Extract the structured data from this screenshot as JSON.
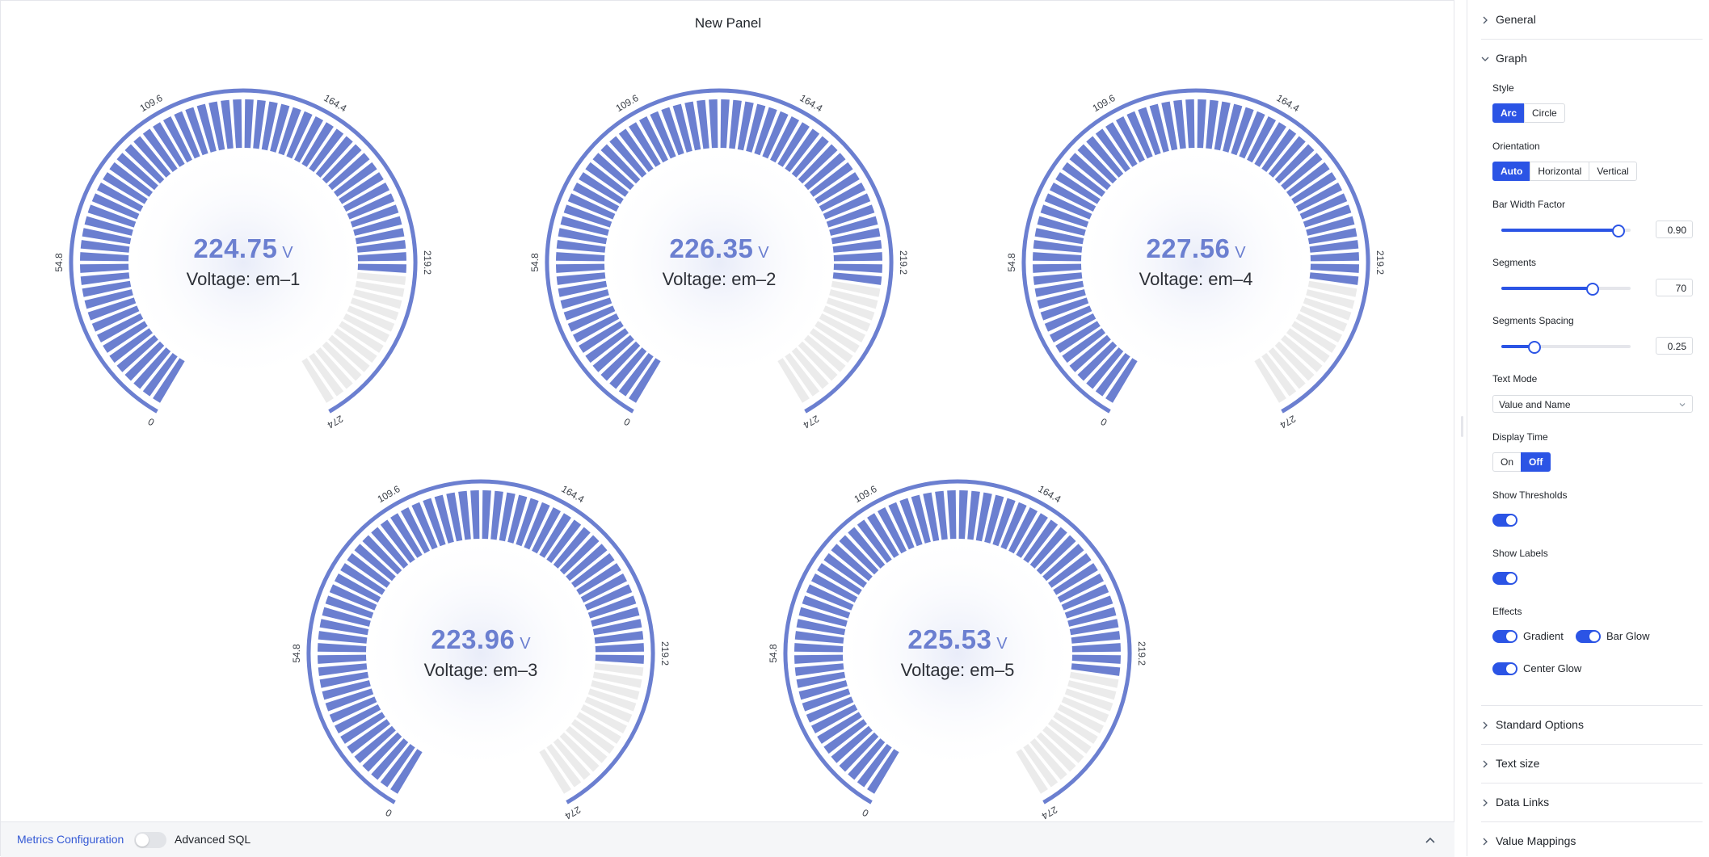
{
  "panel": {
    "title": "New Panel"
  },
  "gauges": [
    {
      "value": "224.75",
      "unit": "V",
      "name": "Voltage: em–1",
      "numeric_value": 224.75
    },
    {
      "value": "226.35",
      "unit": "V",
      "name": "Voltage: em–2",
      "numeric_value": 226.35
    },
    {
      "value": "227.56",
      "unit": "V",
      "name": "Voltage: em–4",
      "numeric_value": 227.56
    },
    {
      "value": "223.96",
      "unit": "V",
      "name": "Voltage: em–3",
      "numeric_value": 223.96
    },
    {
      "value": "225.53",
      "unit": "V",
      "name": "Voltage: em–5",
      "numeric_value": 225.53
    }
  ],
  "gauge_scale": {
    "min": 0,
    "max": 274,
    "ticks": [
      "0",
      "54.8",
      "109.6",
      "164.4",
      "219.2",
      "274"
    ],
    "segments": 70
  },
  "colors": {
    "accent": "#2b54e5",
    "bar": "#6b7fd0",
    "bar_empty": "#ebebeb",
    "link": "#3358d4"
  },
  "query_bar": {
    "metrics_link": "Metrics Configuration",
    "advanced_sql": "Advanced SQL",
    "advanced_sql_on": false,
    "collapse_icon": "chevron-up-icon"
  },
  "sidebar": {
    "general": "General",
    "graph": "Graph",
    "style_label": "Style",
    "style_options": [
      "Arc",
      "Circle"
    ],
    "style_selected": "Arc",
    "orientation_label": "Orientation",
    "orientation_options": [
      "Auto",
      "Horizontal",
      "Vertical"
    ],
    "orientation_selected": "Auto",
    "bar_width_label": "Bar Width Factor",
    "bar_width_value": "0.90",
    "bar_width_fraction": 0.9,
    "segments_label": "Segments",
    "segments_value": "70",
    "segments_fraction": 0.7,
    "spacing_label": "Segments Spacing",
    "spacing_value": "0.25",
    "spacing_fraction": 0.25,
    "text_mode_label": "Text Mode",
    "text_mode_value": "Value and Name",
    "display_time_label": "Display Time",
    "display_time_options": [
      "On",
      "Off"
    ],
    "display_time_selected": "Off",
    "show_thresholds_label": "Show Thresholds",
    "show_thresholds": true,
    "show_labels_label": "Show Labels",
    "show_labels": true,
    "effects_label": "Effects",
    "effects": {
      "gradient": "Gradient",
      "bar_glow": "Bar Glow",
      "center_glow": "Center Glow"
    },
    "standard_options": "Standard Options",
    "text_size": "Text size",
    "data_links": "Data Links",
    "value_mappings": "Value Mappings"
  }
}
